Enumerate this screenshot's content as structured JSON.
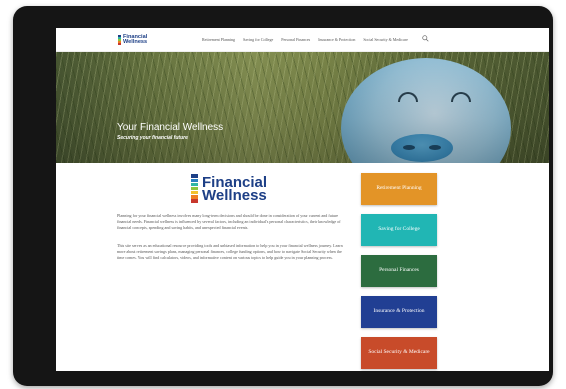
{
  "nav": {
    "logo_line1": "Financial",
    "logo_line2": "Wellness",
    "links": [
      "Retirement Planning",
      "Saving for College",
      "Personal Finances",
      "Insurance & Protection",
      "Social Security & Medicare"
    ],
    "search_icon": "search-icon"
  },
  "hero": {
    "title": "Your Financial Wellness",
    "subtitle": "Securing your financial future"
  },
  "main": {
    "logo_line1": "Financial",
    "logo_line2": "Wellness",
    "logo_bar_colors": [
      "#1d3f86",
      "#2a7fc1",
      "#2fb6a5",
      "#8cc63f",
      "#f2c12e",
      "#ef7d22",
      "#c8372d"
    ],
    "paragraph1": "Planning for your financial wellness involves many long-term decisions and should be done in consideration of your current and future financial needs. Financial wellness is influenced by several factors, including an individual's personal characteristics, their knowledge of financial concepts, spending and saving habits, and unexpected financial events.",
    "paragraph2": "This site serves as an educational resource providing tools and unbiased information to help you in your financial wellness journey. Learn more about retirement savings plans, managing personal finances, college funding options, and how to navigate Social Security when the time comes. You will find calculators, videos, and informative content on various topics to help guide you in your planning process."
  },
  "tiles": [
    {
      "label": "Retirement Planning",
      "color": "#e39427"
    },
    {
      "label": "Saving for College",
      "color": "#21b6b4"
    },
    {
      "label": "Personal Finances",
      "color": "#2c6c3f"
    },
    {
      "label": "Insurance & Protection",
      "color": "#213f93"
    },
    {
      "label": "Social Security & Medicare",
      "color": "#c84b2a"
    }
  ]
}
